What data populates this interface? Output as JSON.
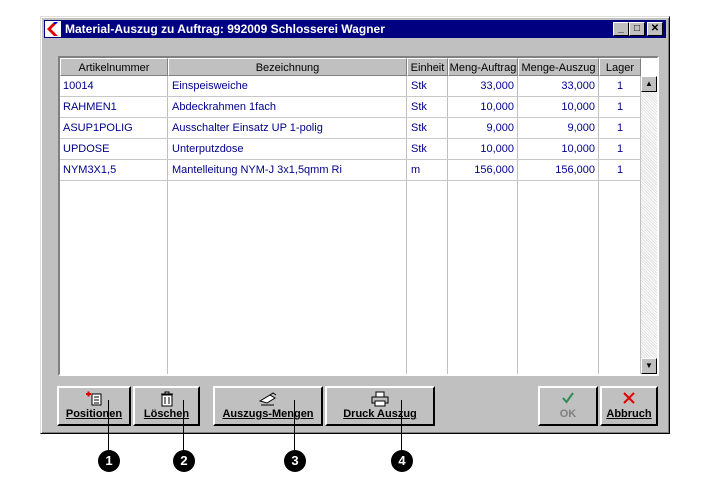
{
  "window": {
    "title": "Material-Auszug zu Auftrag: 992009 Schlosserei Wagner",
    "controls": {
      "minimize": "_",
      "maximize": "□",
      "close": "✕"
    }
  },
  "table": {
    "columns": [
      "Artikelnummer",
      "Bezeichnung",
      "Einheit",
      "Meng-Auftrag",
      "Menge-Auszug",
      "Lager"
    ],
    "rows": [
      [
        "10014",
        "Einspeisweiche",
        "Stk",
        "33,000",
        "33,000",
        "1"
      ],
      [
        "RAHMEN1",
        "Abdeckrahmen 1fach",
        "Stk",
        "10,000",
        "10,000",
        "1"
      ],
      [
        "ASUP1POLIG",
        "Ausschalter Einsatz UP 1-polig",
        "Stk",
        "9,000",
        "9,000",
        "1"
      ],
      [
        "UPDOSE",
        "Unterputzdose",
        "Stk",
        "10,000",
        "10,000",
        "1"
      ],
      [
        "NYM3X1,5",
        "Mantelleitung NYM-J  3x1,5qmm  Ri",
        "m",
        "156,000",
        "156,000",
        "1"
      ]
    ]
  },
  "buttons": {
    "positionen": {
      "label": "Positionen",
      "icon": "add-list-icon"
    },
    "loeschen": {
      "label": "Löschen",
      "icon": "trash-icon"
    },
    "auszugs_mengen": {
      "label": "Auszugs-Mengen",
      "icon": "hand-edit-icon"
    },
    "druck": {
      "label": "Druck Auszug",
      "icon": "printer-icon"
    },
    "ok": {
      "label": "OK",
      "icon": "checkmark-icon"
    },
    "abbruch": {
      "label": "Abbruch",
      "icon": "x-icon"
    }
  },
  "callouts": [
    "1",
    "2",
    "3",
    "4"
  ],
  "colors": {
    "title_bar": "#000080",
    "cell_text": "#00008b",
    "ok_icon": "#2e8b57",
    "cancel_icon": "#e00000"
  }
}
